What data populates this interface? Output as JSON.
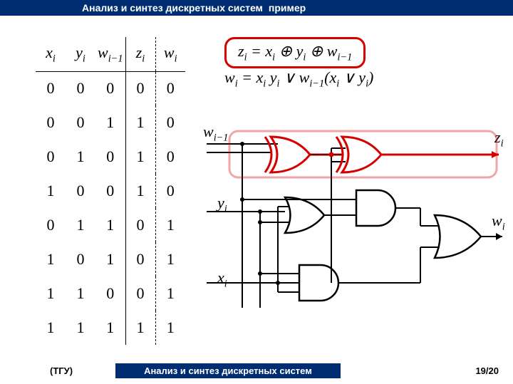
{
  "header": {
    "title": "Анализ и синтез дискретных систем",
    "subtitle": "пример"
  },
  "table": {
    "headers": [
      "x_i",
      "y_i",
      "w_{i-1}",
      "z_i",
      "w_i"
    ],
    "rows": [
      [
        0,
        0,
        0,
        0,
        0
      ],
      [
        0,
        0,
        1,
        1,
        0
      ],
      [
        0,
        1,
        0,
        1,
        0
      ],
      [
        1,
        0,
        0,
        1,
        0
      ],
      [
        0,
        1,
        1,
        0,
        1
      ],
      [
        1,
        0,
        1,
        0,
        1
      ],
      [
        1,
        1,
        0,
        0,
        1
      ],
      [
        1,
        1,
        1,
        1,
        1
      ]
    ]
  },
  "equations": {
    "z": "z_i = x_i ⊕ y_i ⊕ w_{i−1}",
    "w": "w_i = x_i y_i ∨ w_{i−1}(x_i ∨ y_i)"
  },
  "signals": {
    "w_in": "w_{i−1}",
    "y": "y_i",
    "x": "x_i",
    "z": "z_i",
    "w_out": "w_i"
  },
  "footer": {
    "org": "(ТГУ)",
    "title": "Анализ и синтез дискретных систем",
    "page": "19/20"
  }
}
